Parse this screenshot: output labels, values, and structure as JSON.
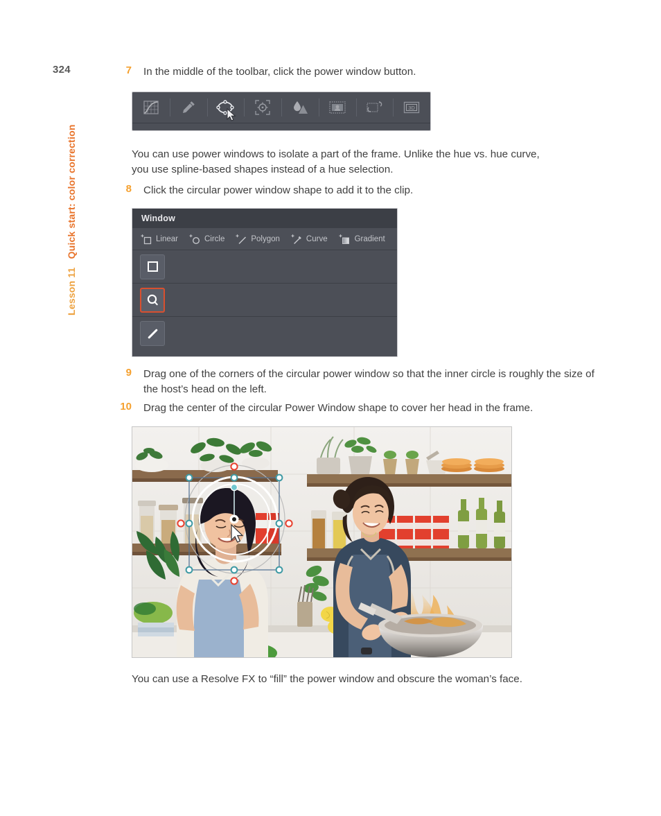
{
  "page": {
    "folio": "324",
    "running_head_lesson": "Lesson 11",
    "running_head_title": "Quick start: color correction",
    "accent_orange": "#f5a02e",
    "accent_title_orange": "#e8732a",
    "body_color": "#3f3f3f"
  },
  "steps": [
    {
      "num": "7",
      "text": "In the middle of the toolbar, click the power window button."
    },
    {
      "num": "8",
      "text": "Click the circular power window shape to add it to the clip."
    },
    {
      "num": "9",
      "text": "Drag one of the corners of the circular power window so that the inner circle is roughly the size of the host’s head on the left."
    },
    {
      "num": "10",
      "text": "Drag the center of the circular Power Window shape to cover her head in the frame."
    }
  ],
  "paragraphs": {
    "after_toolbar": "You can use power windows to isolate a part of the frame. Unlike the hue vs. hue curve, you use spline-based shapes instead of a hue selection.",
    "after_photo": "You can use a Resolve FX to “fill” the power window and obscure the woman’s face."
  },
  "toolbar": {
    "background": "#4c4f57",
    "items": [
      {
        "name": "curves-icon",
        "label": "Curves",
        "active": false
      },
      {
        "name": "qualifier-icon",
        "label": "Qualifier",
        "active": false
      },
      {
        "name": "power-window-icon",
        "label": "Power Windows",
        "active": true
      },
      {
        "name": "tracker-icon",
        "label": "Tracker",
        "active": false
      },
      {
        "name": "blur-icon",
        "label": "Blur",
        "active": false
      },
      {
        "name": "key-icon",
        "label": "Key",
        "active": false
      },
      {
        "name": "sizing-icon",
        "label": "Sizing",
        "active": false
      },
      {
        "name": "stereo-3d-icon",
        "label": "3D",
        "active": false
      }
    ],
    "cursor_on_item_index": 2
  },
  "window_panel": {
    "title": "Window",
    "shape_tools": [
      {
        "label": "Linear",
        "icon": "add-linear-icon"
      },
      {
        "label": "Circle",
        "icon": "add-circle-icon"
      },
      {
        "label": "Polygon",
        "icon": "add-polygon-icon"
      },
      {
        "label": "Curve",
        "icon": "add-curve-icon"
      },
      {
        "label": "Gradient",
        "icon": "add-gradient-icon"
      }
    ],
    "rows": [
      {
        "icon": "linear-window-icon",
        "selected": false
      },
      {
        "icon": "circle-window-icon",
        "selected": true
      },
      {
        "icon": "gradient-window-icon",
        "selected": false
      }
    ],
    "selection_color": "#d9502f"
  },
  "photo": {
    "caption_alt": "Two women in a bright kitchen; circular power window overlay on the left woman's head",
    "overlay": {
      "outer_circle_color": "#ffffff",
      "softness_circle_color": "#bdbdbd",
      "bounding_box_color": "#4d6f93",
      "handle_teal": "#64c0c8",
      "handle_red": "#e8412f",
      "center_handle": "#ffffff"
    }
  }
}
